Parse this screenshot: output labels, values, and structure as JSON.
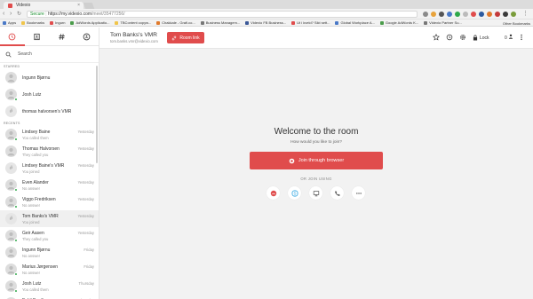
{
  "browser": {
    "tab_title": "Videxio",
    "url_secure_label": "Secure",
    "url_host": "https://my.videxio.com",
    "url_path": "/meet/35477256/",
    "bookmarks": [
      "Apps",
      "Bookmarks",
      "Ingurn",
      "AdWords Applicatio...",
      "TBContent copyw...",
      "Chakkale - Grafi.co...",
      "Business Managem...",
      "Videxio FB Business...",
      "Ut i kveld? Sikt sett...",
      "Global Workplace A...",
      "Google AdWords K...",
      "Videxio Partner Su..."
    ],
    "other_bookmarks": "Other Bookmarks"
  },
  "sidebar": {
    "tabs": [
      {
        "name": "recents-icon"
      },
      {
        "name": "contacts-icon"
      },
      {
        "name": "rooms-icon"
      },
      {
        "name": "dialpad-icon"
      }
    ],
    "search_label": "Search",
    "starred_header": "STARRED",
    "starred": [
      {
        "name": "Ingunn Bjørnu",
        "online": false,
        "room": false
      },
      {
        "name": "Josh Lutz",
        "online": true,
        "room": false
      },
      {
        "name": "thomas halvorsen's VMR",
        "online": false,
        "room": true
      }
    ],
    "recents_header": "RECENTS",
    "recents": [
      {
        "name": "Lindsey Baine",
        "sub": "You called them",
        "date": "Yesterday",
        "online": true,
        "room": false,
        "selected": false
      },
      {
        "name": "Thomas Halvorsen",
        "sub": "They called you",
        "date": "Yesterday",
        "online": false,
        "room": false,
        "selected": false
      },
      {
        "name": "Lindsey Baine's VMR",
        "sub": "You joined",
        "date": "Yesterday",
        "online": false,
        "room": true,
        "selected": false
      },
      {
        "name": "Even Alander",
        "sub": "No answer",
        "date": "Yesterday",
        "online": true,
        "room": false,
        "selected": false
      },
      {
        "name": "Viggo Fredriksen",
        "sub": "No answer",
        "date": "Yesterday",
        "online": true,
        "room": false,
        "selected": false
      },
      {
        "name": "Tom Banks's VMR",
        "sub": "You joined",
        "date": "Yesterday",
        "online": false,
        "room": true,
        "selected": true
      },
      {
        "name": "Geir Aasen",
        "sub": "They called you",
        "date": "Yesterday",
        "online": true,
        "room": false,
        "selected": false
      },
      {
        "name": "Ingunn Bjørnu",
        "sub": "No answer",
        "date": "Friday",
        "online": false,
        "room": false,
        "selected": false
      },
      {
        "name": "Marius Jørgensen",
        "sub": "No answer",
        "date": "Friday",
        "online": true,
        "room": false,
        "selected": false
      },
      {
        "name": "Josh Lutz",
        "sub": "You called them",
        "date": "Thursday",
        "online": true,
        "room": false,
        "selected": false
      },
      {
        "name": "Eskil Bradley",
        "sub": "",
        "date": "Thursday",
        "online": false,
        "room": false,
        "selected": false
      }
    ]
  },
  "header": {
    "room_title": "Tom Banks's VMR",
    "room_email": "tom.banks.vmr@videxio.com",
    "room_link_label": "Room link",
    "lock_label": "Lock",
    "participant_count": "0"
  },
  "main": {
    "welcome": "Welcome to the room",
    "question": "How would you like to join?",
    "join_browser_label": "Join through browser",
    "or_join_label": "OR JOIN USING",
    "options": [
      {
        "name": "app-join-icon",
        "color": "#e04c4c"
      },
      {
        "name": "skype-join-icon",
        "color": "#2aa3e0"
      },
      {
        "name": "video-system-join-icon",
        "color": "#555555"
      },
      {
        "name": "phone-join-icon",
        "color": "#555555"
      },
      {
        "name": "more-options-icon",
        "color": "#555555"
      }
    ]
  },
  "colors": {
    "accent": "#e04c4c",
    "online": "#2ea84a"
  }
}
